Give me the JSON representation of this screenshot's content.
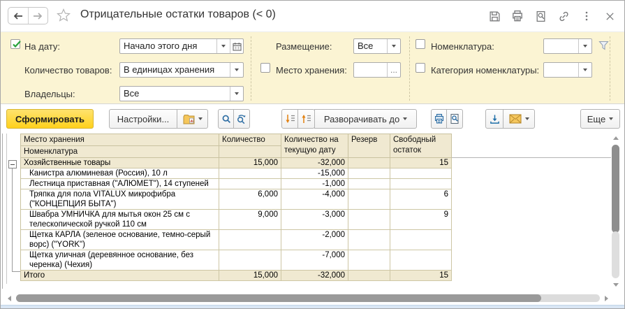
{
  "window": {
    "title": "Отрицательные остатки товаров (< 0)"
  },
  "filters": {
    "on_date": {
      "label": "На дату:",
      "value": "Начало этого дня",
      "checked": true
    },
    "qty_goods": {
      "label": "Количество товаров:",
      "value": "В единицах хранения"
    },
    "owners": {
      "label": "Владельцы:",
      "value": "Все"
    },
    "placement": {
      "label": "Размещение:",
      "value": "Все"
    },
    "storage_place": {
      "label": "Место хранения:",
      "value": "",
      "more": "..."
    },
    "nomenclature": {
      "label": "Номенклатура:",
      "value": ""
    },
    "nomenclature_category": {
      "label": "Категория номенклатуры:",
      "value": ""
    }
  },
  "toolbar": {
    "generate": "Сформировать",
    "settings": "Настройки...",
    "expand_to": "Разворачивать до",
    "more": "Еще"
  },
  "table": {
    "header": {
      "level1": "Место хранения",
      "level2": "Номенклатура",
      "qty": "Количество",
      "qty_current": "Количество на текущую дату",
      "reserve": "Резерв",
      "free": "Свободный остаток"
    },
    "rows": [
      {
        "type": "group",
        "name": "Хозяйственные товары",
        "qty": "15,000",
        "qty_current": "-32,000",
        "reserve": "",
        "free": "15"
      },
      {
        "type": "item",
        "name": "Канистра алюминевая (Россия), 10 л",
        "qty": "",
        "qty_current": "-15,000",
        "reserve": "",
        "free": ""
      },
      {
        "type": "item",
        "name": "Лестница приставная (\"АЛЮМЕТ\"), 14 ступеней",
        "qty": "",
        "qty_current": "-1,000",
        "reserve": "",
        "free": ""
      },
      {
        "type": "item",
        "name": "Тряпка для пола VITALUX микрофибра (\"КОНЦЕПЦИЯ БЫТА\")",
        "qty": "6,000",
        "qty_current": "-4,000",
        "reserve": "",
        "free": "6"
      },
      {
        "type": "item",
        "name": "Швабра УМНИЧКА для мытья окон 25 см с телескопической ручкой 110 см",
        "qty": "9,000",
        "qty_current": "-3,000",
        "reserve": "",
        "free": "9"
      },
      {
        "type": "item",
        "name": "Щетка КАРЛА (зеленое основание, темно-серый ворс) (\"YORK\")",
        "qty": "",
        "qty_current": "-2,000",
        "reserve": "",
        "free": ""
      },
      {
        "type": "item",
        "name": "Щетка уличная (деревянное основание, без черенка) (Чехия)",
        "qty": "",
        "qty_current": "-7,000",
        "reserve": "",
        "free": ""
      }
    ],
    "total": {
      "name": "Итого",
      "qty": "15,000",
      "qty_current": "-32,000",
      "reserve": "",
      "free": "15"
    }
  }
}
